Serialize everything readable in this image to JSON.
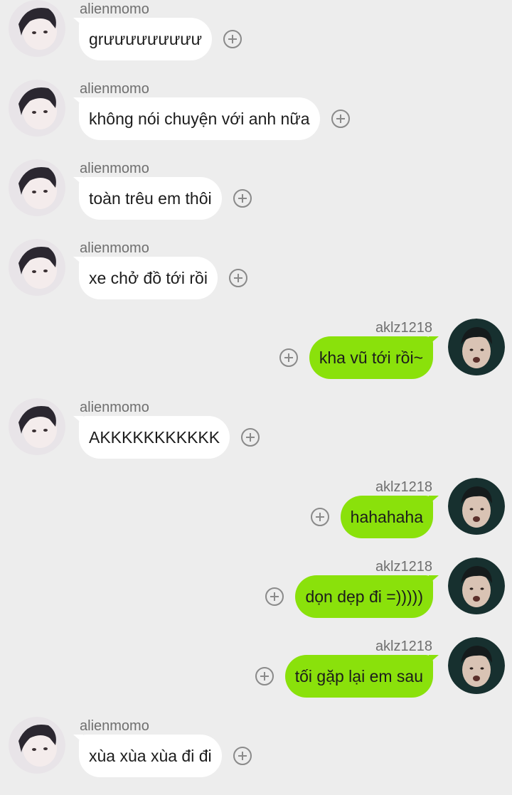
{
  "conversation": {
    "messages": [
      {
        "direction": "in",
        "sender": "alienmomo",
        "text": "grưưưưưưưưư"
      },
      {
        "direction": "in",
        "sender": "alienmomo",
        "text": "không nói chuyện với anh nữa"
      },
      {
        "direction": "in",
        "sender": "alienmomo",
        "text": "toàn trêu em thôi"
      },
      {
        "direction": "in",
        "sender": "alienmomo",
        "text": "xe chở đồ tới rồi"
      },
      {
        "direction": "out",
        "sender": "aklz1218",
        "text": "kha vũ tới rồi~"
      },
      {
        "direction": "in",
        "sender": "alienmomo",
        "text": "AKKKKKKKKKKK"
      },
      {
        "direction": "out",
        "sender": "aklz1218",
        "text": "hahahaha"
      },
      {
        "direction": "out",
        "sender": "aklz1218",
        "text": "dọn dẹp đi =)))))"
      },
      {
        "direction": "out",
        "sender": "aklz1218",
        "text": "tối gặp lại em sau"
      },
      {
        "direction": "in",
        "sender": "alienmomo",
        "text": "xùa xùa xùa đi đi"
      }
    ]
  },
  "colors": {
    "background": "#ededed",
    "incoming_bubble": "#ffffff",
    "outgoing_bubble": "#8ae10b",
    "sender_name": "#6f6f6f"
  },
  "icons": {
    "add_reaction": "plus-circle-icon",
    "avatar_in": "avatar-alienmomo",
    "avatar_out": "avatar-aklz1218"
  }
}
